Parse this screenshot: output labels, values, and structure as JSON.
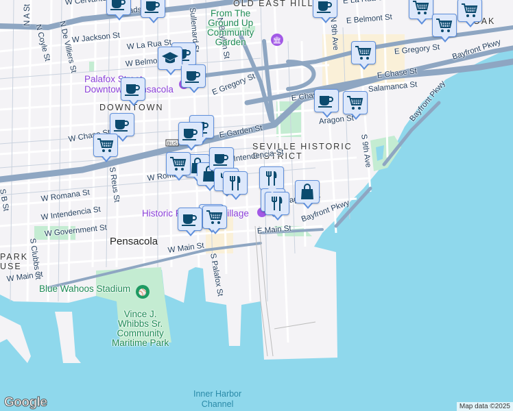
{
  "labels": [
    "W Cervantes St",
    "W Gadsden St",
    "N A St",
    "N Coyle St",
    "N De Villiers St",
    "W Jackson St",
    "W La Rua St",
    "W Belmont St",
    "N Baylen St",
    "Sullemard St",
    "OLD EAST HILL",
    "From The\nGround Up\nCommunity\nGarden",
    "E La Rua St",
    "E Belmont St",
    "N 9th Ave",
    "OAK",
    "E Gregory St",
    "E Gregory St",
    "E Chase St",
    "E Chase St",
    "Salamanca St",
    "Aragon St",
    "S 9th Ave",
    "Bayfront Pkwy",
    "Bayfront Pkwy",
    "Palafox Street\nDowntown Pensacola",
    "DOWNTOWN",
    "W Chase St",
    "E Garden St",
    "W Romana St",
    "W Romana St",
    "S Reus St",
    "S B St",
    "SEVILLE HISTORIC\nDISTRICT",
    "Zaragoza St",
    "E Main St",
    "Bayfront Pkwy",
    "Historic Pensacola Village",
    "W Intendencia St",
    "W Government St",
    "Pensacola",
    "PARK\nUSE",
    "S Clubbs St",
    "W Main St",
    "W Main St",
    "S Palafox St",
    "Blue Wahoos Stadium",
    "Vince J.\nWhibbs Sr.\nCommunity\nMaritime Park",
    "Inner Harbor\nChannel",
    "E Intendencia St"
  ],
  "markers": [
    "cafe",
    "cafe",
    "cafe",
    "cafe",
    "education",
    "cafe",
    "cafe",
    "cafe",
    "cart",
    "cafe",
    "cafe",
    "cart",
    "cart",
    "bag",
    "bag",
    "cafe",
    "restaurant",
    "restaurant",
    "cart",
    "cart",
    "cart",
    "cart",
    "cafe",
    "cart",
    "restaurant",
    "restaurant",
    "restaurant",
    "bag",
    "cart",
    "cafe"
  ],
  "icons": {
    "cafe": "coffee-cup-icon",
    "cart": "shopping-cart-icon",
    "bag": "shopping-bag-icon",
    "restaurant": "fork-knife-icon",
    "education": "graduation-cap-icon",
    "museum": "museum-icon",
    "stadium": "stadium-icon",
    "bus": "bus-route-icon"
  },
  "bus_shield": "BUS",
  "logo": "Google",
  "attribution": "Map data ©2025",
  "colors": {
    "water": "#8fd8ec",
    "land": "#f4f3f6",
    "park": "#c4ecd2",
    "highway": "#8ea6c2",
    "marker_fill": "#dde8fb",
    "marker_border": "#5e8fdc",
    "icon": "#0b4a6e"
  }
}
